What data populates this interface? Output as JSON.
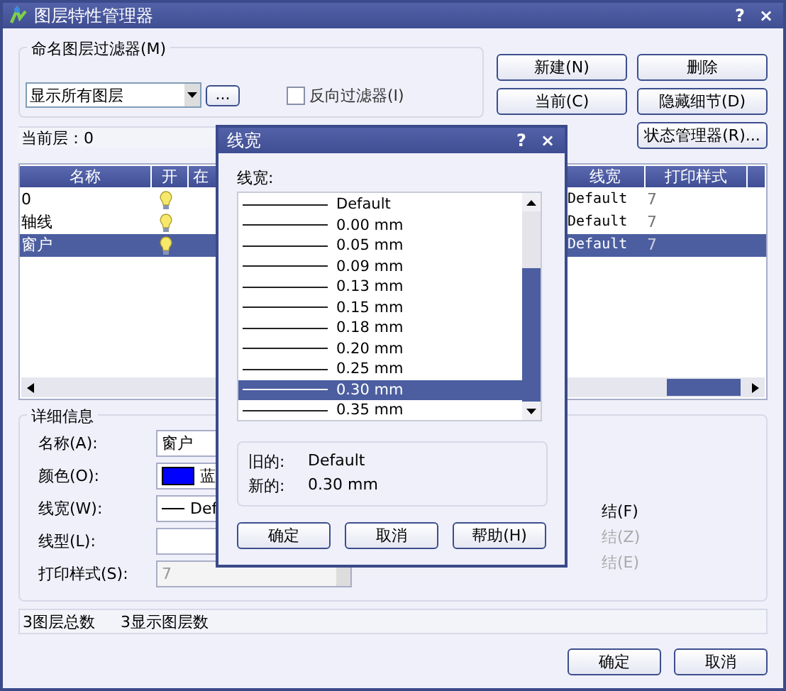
{
  "window": {
    "title": "图层特性管理器",
    "help": "?",
    "close": "×"
  },
  "filter": {
    "label": "命名图层过滤器(M)",
    "value": "显示所有图层",
    "browse": "...",
    "invert": {
      "label": "反向过滤器(I)",
      "checked": false
    }
  },
  "buttons": [
    {
      "label": "新建(N)"
    },
    {
      "label": "删除"
    },
    {
      "label": "当前(C)"
    },
    {
      "label": "隐藏细节(D)"
    },
    {
      "label": "状态管理器(R)..."
    }
  ],
  "current_layer": "当前层：0",
  "layers": {
    "columns": [
      "名称",
      "开",
      "在",
      "线宽",
      "打印样式"
    ],
    "rows": [
      {
        "name": "0",
        "on": true,
        "lineweight": "Default",
        "plot_style": "7",
        "selected": false
      },
      {
        "name": "轴线",
        "on": true,
        "lineweight": "Default",
        "plot_style": "7",
        "selected": false
      },
      {
        "name": "窗户",
        "on": true,
        "lineweight": "Default",
        "plot_style": "7",
        "selected": true
      }
    ]
  },
  "details": {
    "title": "详细信息",
    "fields": [
      {
        "label": "名称(A):",
        "kind": "text",
        "value": "窗户"
      },
      {
        "label": "颜色(O):",
        "kind": "color",
        "value": "蓝",
        "color": "#0000ff"
      },
      {
        "label": "线宽(W):",
        "kind": "lineweight",
        "value": "Def"
      },
      {
        "label": "线型(L):",
        "kind": "text"
      },
      {
        "label": "打印样式(S):",
        "kind": "combo",
        "value": "7",
        "disabled": true
      }
    ],
    "options": [
      {
        "label": "结(F)",
        "disabled": false
      },
      {
        "label": "结(Z)",
        "disabled": true
      },
      {
        "label": "结(E)",
        "disabled": true
      }
    ]
  },
  "status": [
    "3图层总数",
    "3显示图层数"
  ],
  "footer_buttons": [
    "确定",
    "取消"
  ],
  "dialog": {
    "title": "线宽",
    "help": "?",
    "close": "×",
    "label": "线宽:",
    "items": [
      {
        "label": "Default",
        "selected": false
      },
      {
        "label": "0.00 mm",
        "selected": false
      },
      {
        "label": "0.05 mm",
        "selected": false
      },
      {
        "label": "0.09 mm",
        "selected": false
      },
      {
        "label": "0.13 mm",
        "selected": false
      },
      {
        "label": "0.15 mm",
        "selected": false
      },
      {
        "label": "0.18 mm",
        "selected": false
      },
      {
        "label": "0.20 mm",
        "selected": false
      },
      {
        "label": "0.25 mm",
        "selected": false
      },
      {
        "label": "0.30 mm",
        "selected": true
      },
      {
        "label": "0.35 mm",
        "selected": false
      }
    ],
    "old_label": "旧的:",
    "old_value": "Default",
    "new_label": "新的:",
    "new_value": "0.30 mm",
    "buttons": [
      "确定",
      "取消",
      "帮助(H)"
    ]
  }
}
